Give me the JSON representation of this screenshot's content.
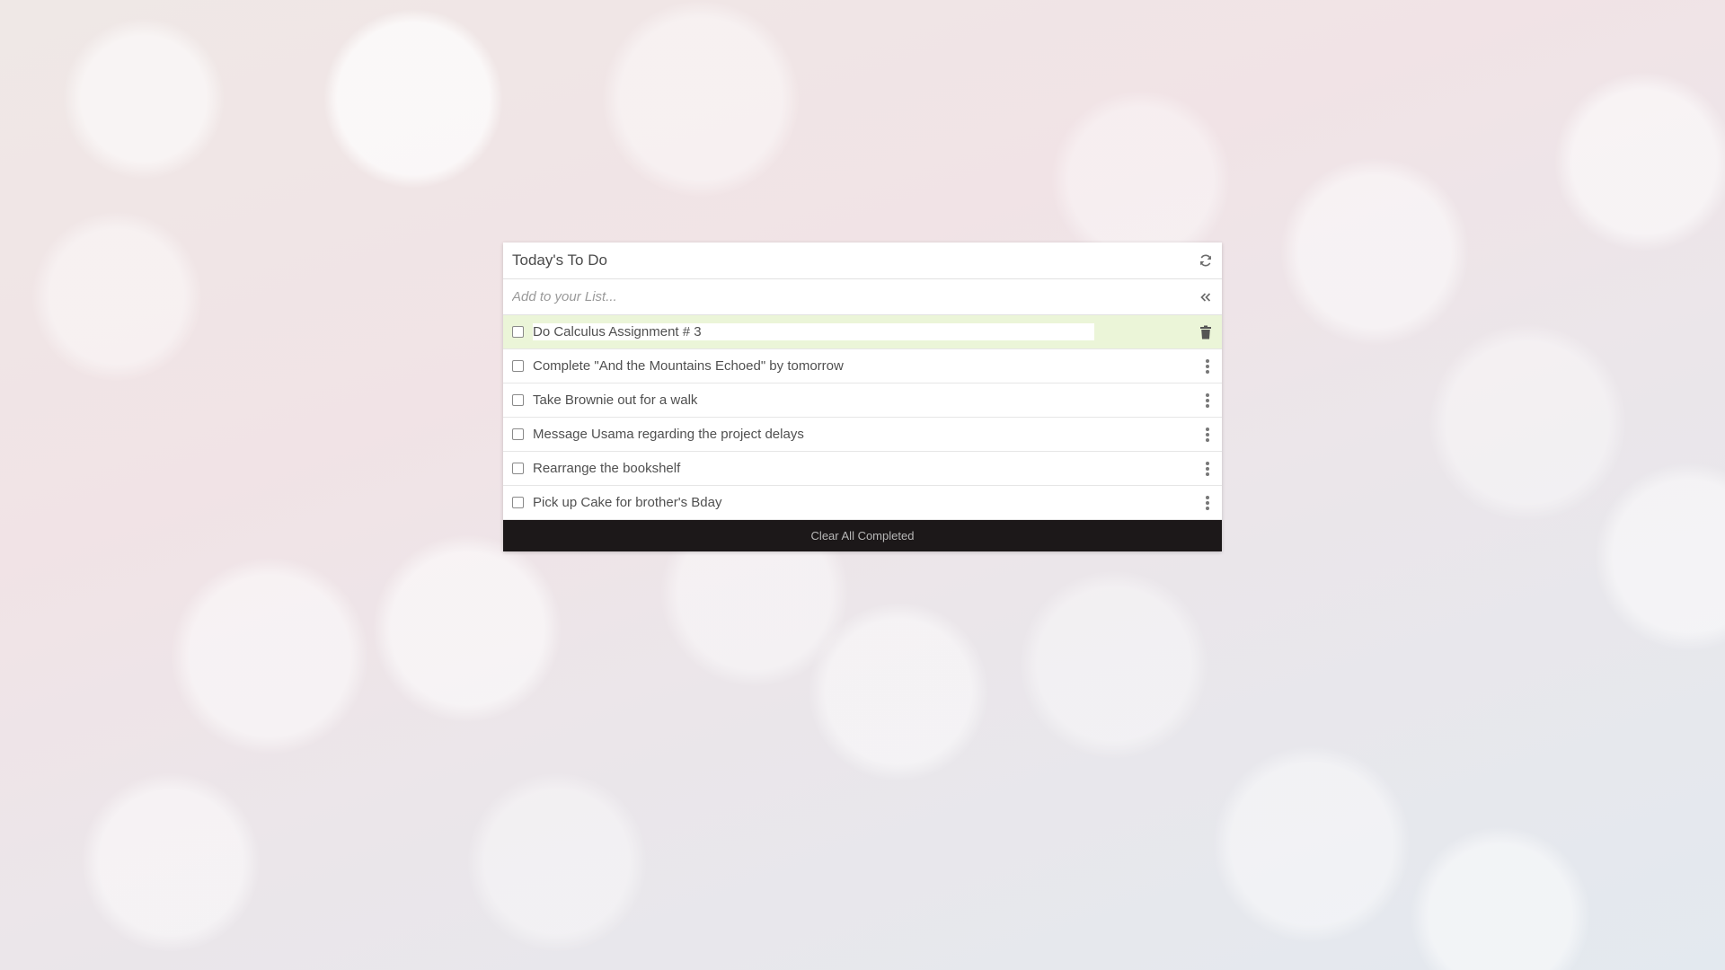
{
  "background": {
    "base_color": "#ece4e6"
  },
  "card": {
    "title": "Today's To Do",
    "refresh_icon": "refresh-icon",
    "add_input": {
      "placeholder": "Add to your List...",
      "value": ""
    },
    "collapse_icon": "double-chevron-left-icon",
    "items": [
      {
        "text": "Do Calculus Assignment # 3",
        "checked": false,
        "active": true,
        "action_icon": "trash-icon"
      },
      {
        "text": "Complete \"And the Mountains Echoed\" by tomorrow",
        "checked": false,
        "active": false,
        "action_icon": "kebab-menu-icon"
      },
      {
        "text": "Take Brownie out for a walk",
        "checked": false,
        "active": false,
        "action_icon": "kebab-menu-icon"
      },
      {
        "text": "Message Usama regarding the project delays",
        "checked": false,
        "active": false,
        "action_icon": "kebab-menu-icon"
      },
      {
        "text": "Rearrange the bookshelf",
        "checked": false,
        "active": false,
        "action_icon": "kebab-menu-icon"
      },
      {
        "text": "Pick up Cake for brother's Bday",
        "checked": false,
        "active": false,
        "action_icon": "kebab-menu-icon"
      }
    ],
    "clear_button_label": "Clear All Completed",
    "colors": {
      "active_row": "#ebf5d8",
      "footer_bar": "#1c1819",
      "footer_text": "#b8b8b8"
    }
  }
}
